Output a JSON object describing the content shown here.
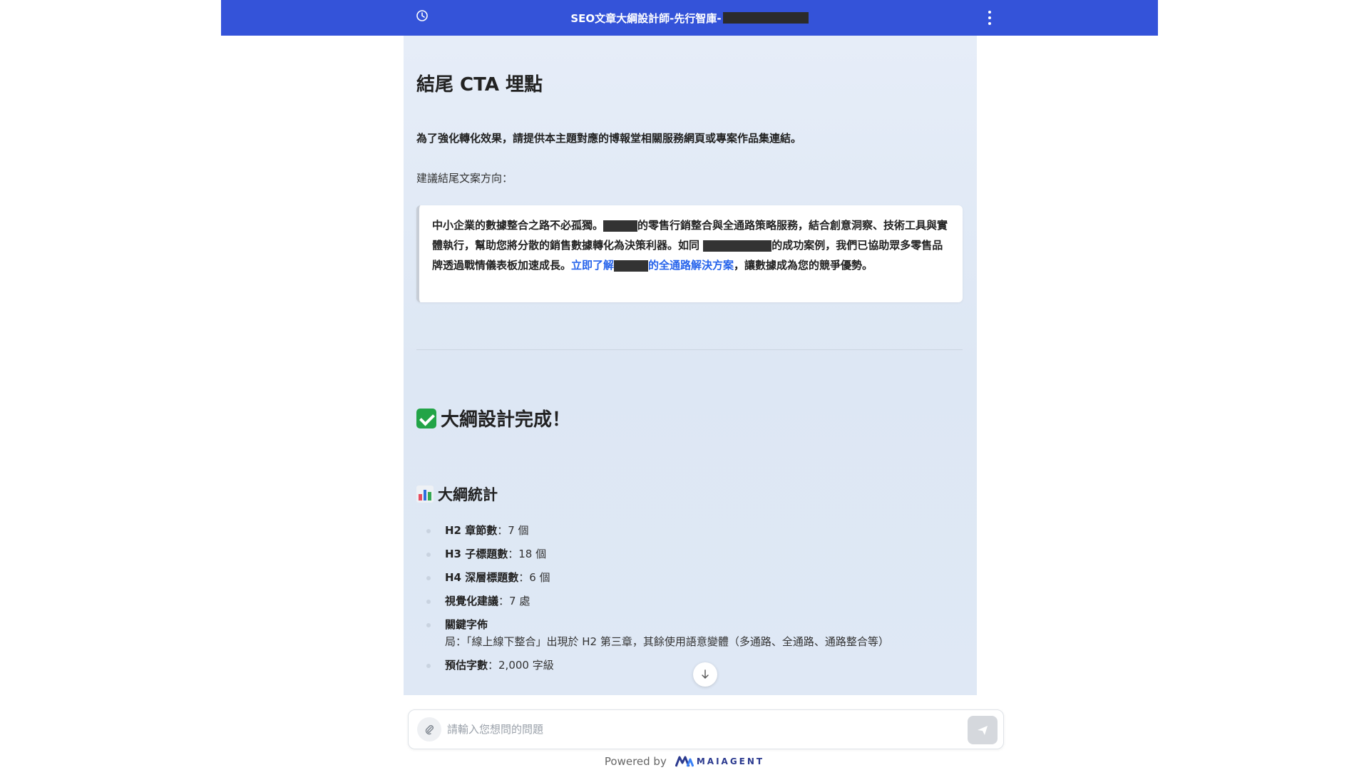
{
  "header": {
    "title": "SEO文章大綱設計師-先行智庫-",
    "clock_icon": "clock-icon",
    "menu_icon": "kebab-menu-icon",
    "color": "#3453d9"
  },
  "content": {
    "cta_heading": "結尾 CTA 埋點",
    "cta_intro": "為了強化轉化效果，請提供本主題對應的博報堂相關服務網頁或專案作品集連結。",
    "cta_direction": "建議結尾文案方向：",
    "quote": {
      "part1": "中小企業的數據整合之路不必孤獨。",
      "part2": "的零售行銷整合與全通路策略服務，結合創意洞察、技術工具與實體執行，幫助您將分散的銷售數據轉化為決策利器。如同",
      "part3": "的成功案例，我們已協助眾多零售品牌透過戰情儀表板加速成長。",
      "link_part1": "立即了解",
      "link_part2": "的全通路解決方案",
      "part4": "，讓數據成為您的競爭優勢。"
    },
    "done_heading": "大綱設計完成！",
    "stats_heading": "大綱統計",
    "stats": [
      {
        "label": "H2 章節數",
        "value": "：7 個"
      },
      {
        "label": "H3 子標題數",
        "value": "：18 個"
      },
      {
        "label": "H4 深層標題數",
        "value": "：6 個"
      },
      {
        "label": "視覺化建議",
        "value": "：7 處"
      },
      {
        "label": "關鍵字佈",
        "value": "局：「線上線下整合」出現於 H2 第三章，其餘使用語意變體（多通路、全通路、通路整合等）"
      },
      {
        "label": "預估字數",
        "value": "：2,000 字級"
      }
    ]
  },
  "input": {
    "placeholder": "請輸入您想問的問題",
    "attach_icon": "paperclip-icon",
    "send_icon": "send-icon"
  },
  "footer": {
    "powered_by": "Powered by",
    "brand": "MAIAGENT"
  }
}
